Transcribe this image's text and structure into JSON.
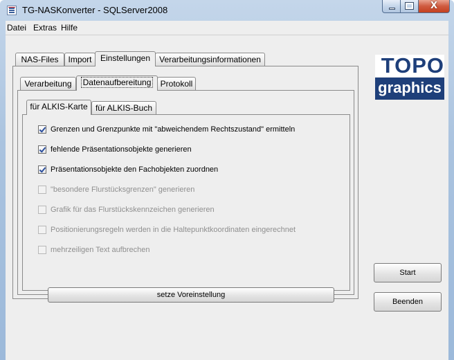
{
  "window": {
    "title": "TG-NASKonverter - SQLServer2008",
    "close_glyph": "X"
  },
  "menu": [
    "Datei",
    "Extras",
    "Hilfe"
  ],
  "main_tabs": [
    "NAS-Files",
    "Import",
    "Einstellungen",
    "Verarbeitungsinformationen"
  ],
  "main_tab_active": "Einstellungen",
  "sub_tabs": [
    "Verarbeitung",
    "Datenaufbereitung",
    "Protokoll"
  ],
  "sub_tab_active": "Datenaufbereitung",
  "inner_tabs": [
    "für ALKIS-Karte",
    "für ALKIS-Buch"
  ],
  "inner_tab_active": "für ALKIS-Karte",
  "options": [
    {
      "label": "Grenzen und Grenzpunkte mit \"abweichendem Rechtszustand\" ermitteln",
      "checked": true,
      "enabled": true
    },
    {
      "label": "fehlende Präsentationsobjekte generieren",
      "checked": true,
      "enabled": true
    },
    {
      "label": "Präsentationsobjekte den Fachobjekten zuordnen",
      "checked": true,
      "enabled": true
    },
    {
      "label": "\"besondere Flurstücksgrenzen\" generieren",
      "checked": false,
      "enabled": false
    },
    {
      "label": "Grafik für das Flurstückskennzeichen generieren",
      "checked": false,
      "enabled": false
    },
    {
      "label": "Positionierungsregeln werden in die Haltepunktkoordinaten eingerechnet",
      "checked": false,
      "enabled": false
    },
    {
      "label": "mehrzeiligen Text aufbrechen",
      "checked": false,
      "enabled": false
    }
  ],
  "buttons": {
    "defaults": "setze Voreinstellung",
    "start": "Start",
    "quit": "Beenden"
  },
  "logo": {
    "line1": "TOPO",
    "line2": "graphics",
    "brand_color": "#1e3f7a"
  },
  "icons": {
    "app": "window-app-icon",
    "minimize": "minimize-icon",
    "maximize": "maximize-icon",
    "close": "close-icon"
  }
}
